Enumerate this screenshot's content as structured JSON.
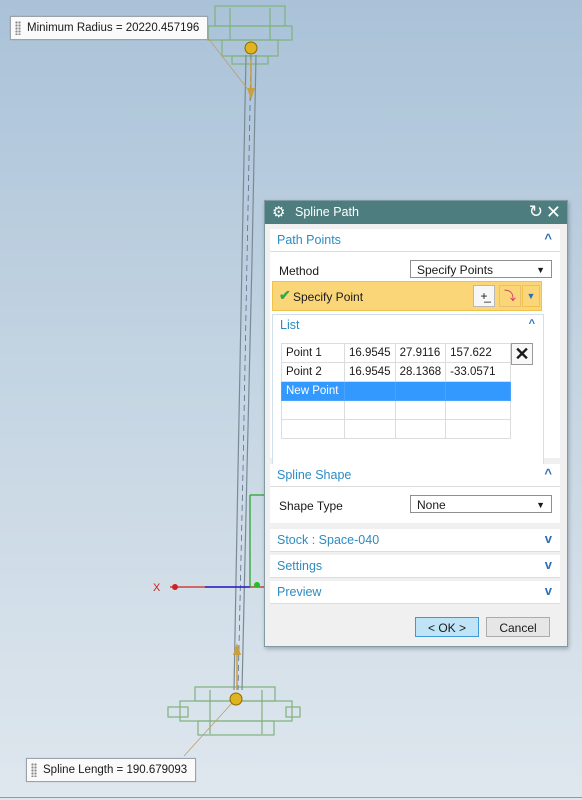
{
  "callouts": {
    "min_radius": "Minimum Radius = 20220.457196",
    "spline_length": "Spline Length = 190.679093"
  },
  "axis": {
    "x_label": "X"
  },
  "dialog": {
    "title": "Spline Path",
    "path_points": {
      "header": "Path Points",
      "method_label": "Method",
      "method_value": "Specify Points",
      "specify_point_label": "Specify Point",
      "list": {
        "header": "List",
        "rows": [
          [
            "Point 1",
            "16.9545",
            "27.9116",
            "157.622"
          ],
          [
            "Point 2",
            "16.9545",
            "28.1368",
            "-33.0571"
          ],
          [
            "New Point",
            "",
            "",
            ""
          ]
        ]
      }
    },
    "spline_shape": {
      "header": "Spline Shape",
      "shape_type_label": "Shape Type",
      "shape_type_value": "None"
    },
    "stock_header": "Stock : Space-040",
    "settings_header": "Settings",
    "preview_header": "Preview",
    "ok_label": "< OK >",
    "cancel_label": "Cancel"
  },
  "colors": {
    "titlebar": "#4e7d80",
    "section_header_text": "#2d8bc3",
    "selection": "#3399ff",
    "highlight_row": "#fbd679"
  }
}
